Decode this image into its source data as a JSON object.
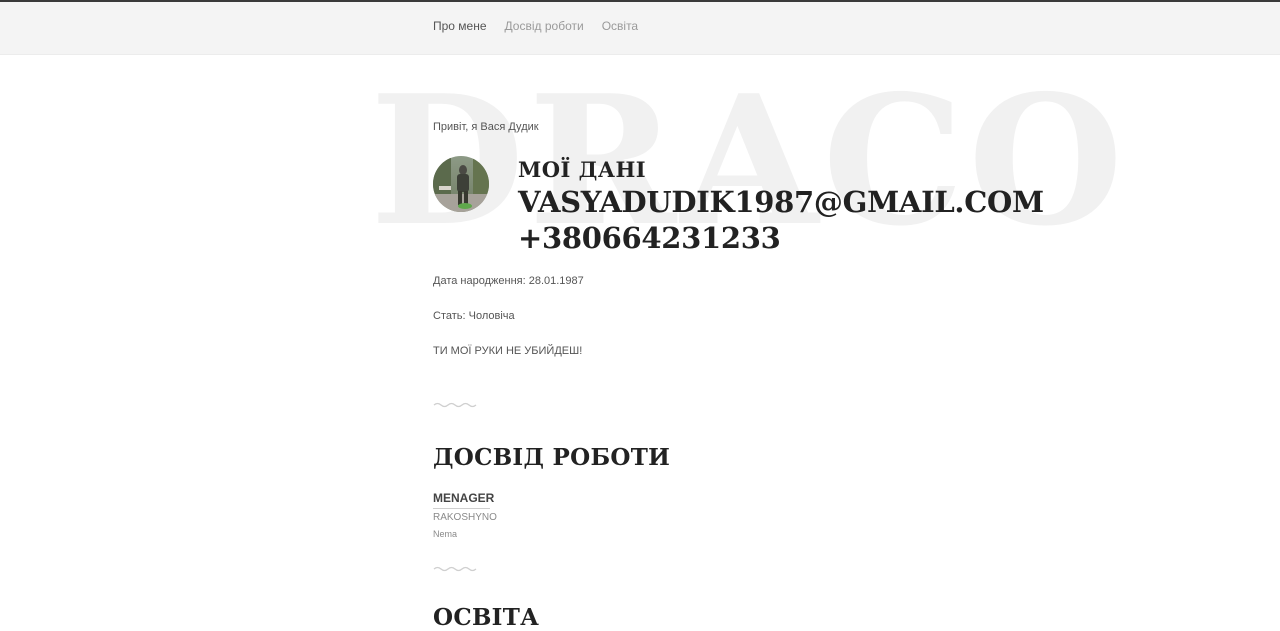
{
  "nav": {
    "items": [
      {
        "label": "Про мене"
      },
      {
        "label": "Досвід роботи"
      },
      {
        "label": "Освіта"
      }
    ]
  },
  "watermark": "DRACO",
  "about": {
    "greeting": "Привіт, я Вася Дудик",
    "contact_title": "МОЇ ДАНІ",
    "email": "VASYADUDIK1987@GMAIL.COM",
    "phone": "+380664231233",
    "birth_date": "Дата народження: 28.01.1987",
    "gender": "Стать: Чоловіча",
    "quote": "ТИ МОЇ РУКИ НЕ УБИЙДЕШ!"
  },
  "experience": {
    "title": "ДОСВІД РОБОТИ",
    "job_title": "MENAGER",
    "company": "RAKOSHYNO",
    "description": "Nema"
  },
  "education": {
    "title": "ОСВІТА"
  },
  "colors": {
    "navbar_bg": "#f4f4f4",
    "heading": "#222222",
    "muted": "#9a9a9a",
    "watermark": "#f1f1f1"
  }
}
